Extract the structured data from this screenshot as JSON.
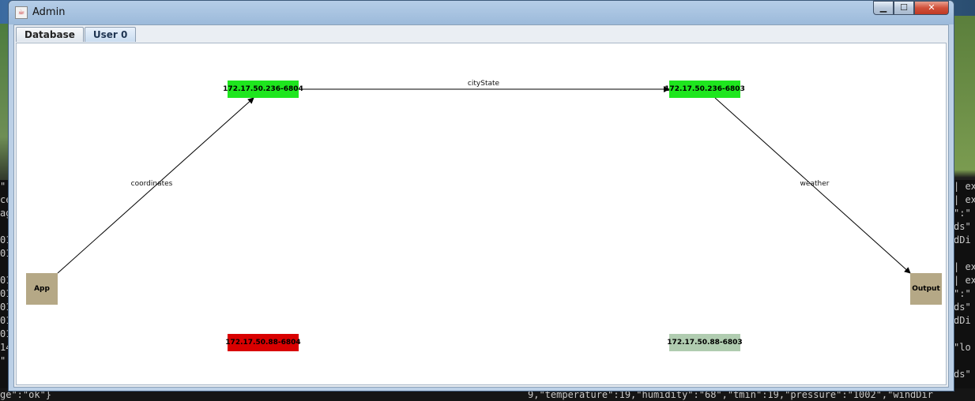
{
  "window": {
    "title": "Admin"
  },
  "tabs": [
    {
      "label": "Database",
      "active": false
    },
    {
      "label": "User 0",
      "active": true
    }
  ],
  "graph": {
    "nodes": {
      "app": {
        "label": "App",
        "color": "#b5a886"
      },
      "output": {
        "label": "Output",
        "color": "#b5a886"
      },
      "n6804_active": {
        "label": "172.17.50.236-6804",
        "color": "#1ee61e"
      },
      "n6803_active": {
        "label": "172.17.50.236-6803",
        "color": "#1ee61e"
      },
      "n6804_down": {
        "label": "172.17.50.88-6804",
        "color": "#d90000"
      },
      "n6803_idle": {
        "label": "172.17.50.88-6803",
        "color": "#b0ccb0"
      }
    },
    "edges": [
      {
        "from": "app",
        "to": "n6804_active",
        "label": "coordinates"
      },
      {
        "from": "n6804_active",
        "to": "n6803_active",
        "label": "cityState"
      },
      {
        "from": "n6803_active",
        "to": "output",
        "label": "weather"
      }
    ]
  },
  "background_terminal": {
    "right_lines": [
      "| ex",
      "| ex",
      "\":\"",
      "ds\"",
      "dDi",
      "",
      "| ex",
      "| ex",
      "\":\"",
      "ds\"",
      "dDi",
      "",
      "\"lo",
      "",
      "ds\""
    ],
    "left_lines": [
      "\"",
      "ce",
      "ag",
      "",
      "01",
      "01",
      "",
      "01",
      "01",
      "01",
      "01",
      "01",
      "14",
      "\""
    ],
    "bottom_left": "ge\":\"ok\"}",
    "bottom_right": "9,\"temperature\":19,\"humidity\":\"68\",\"tmin\":19,\"pressure\":\"1002\",\"windDir"
  }
}
